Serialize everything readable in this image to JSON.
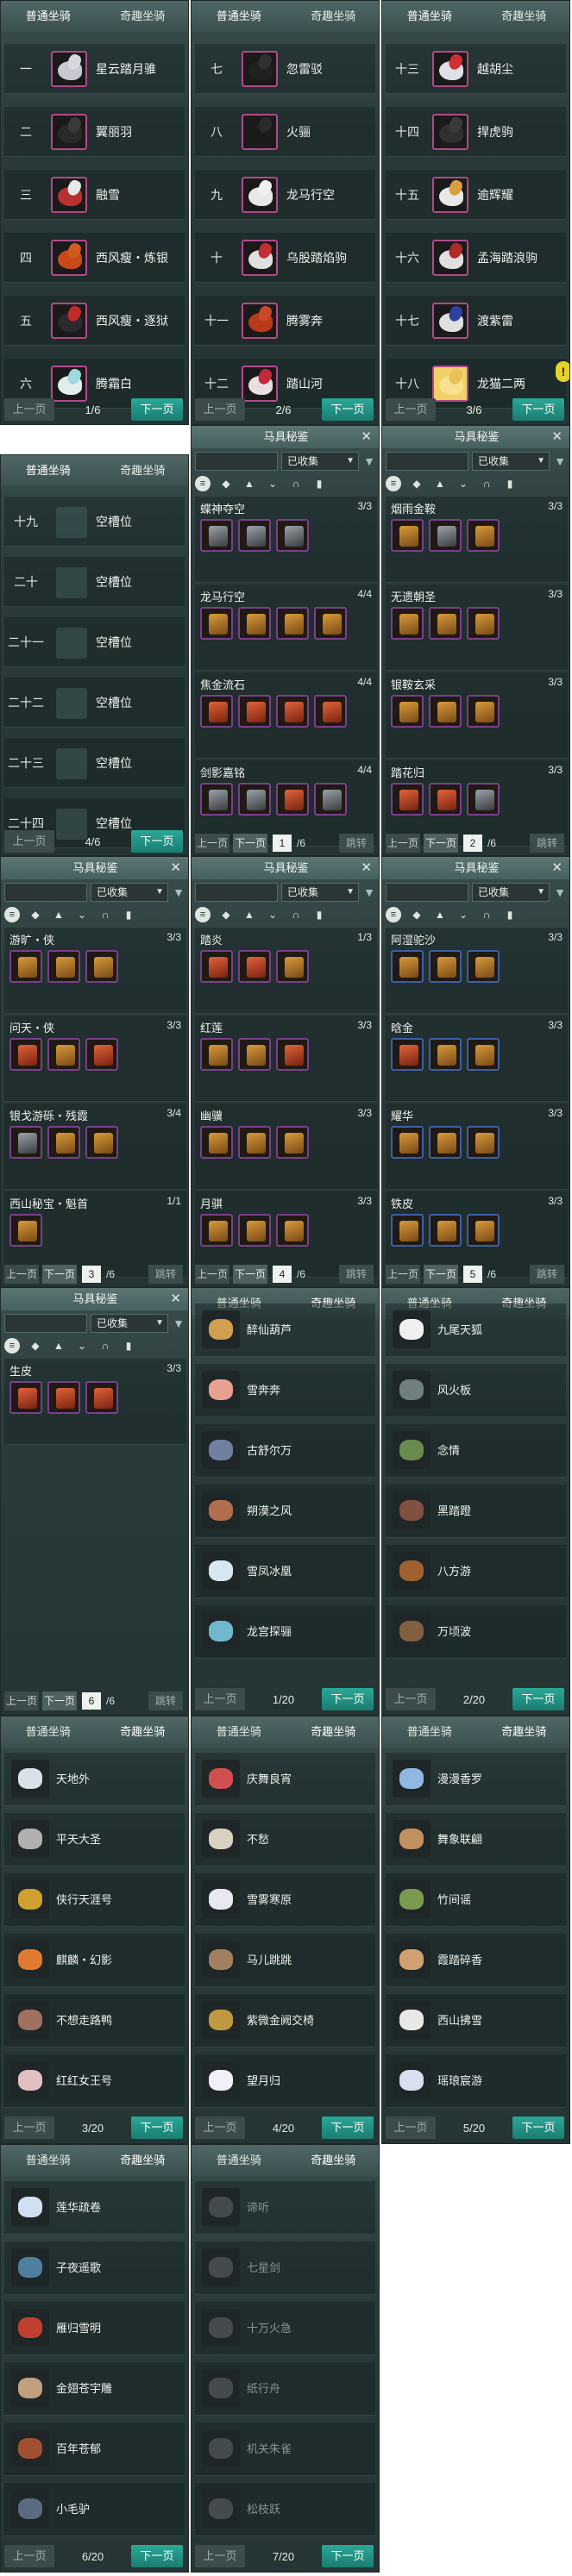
{
  "tabs": {
    "normal": "普通坐骑",
    "fun": "奇趣坐骑"
  },
  "pager": {
    "prev": "上一页",
    "next": "下一页"
  },
  "panel_normal_1": {
    "rows": [
      {
        "num": "一",
        "name": "星云踏月骓"
      },
      {
        "num": "二",
        "name": "翼丽羽"
      },
      {
        "num": "三",
        "name": "融雪"
      },
      {
        "num": "四",
        "name": "西风瘦・炼银"
      },
      {
        "num": "五",
        "name": "西风瘦・逐狱"
      },
      {
        "num": "六",
        "name": "腾霜白"
      }
    ],
    "page": "1/6"
  },
  "panel_normal_2": {
    "rows": [
      {
        "num": "七",
        "name": "忽雷驳"
      },
      {
        "num": "八",
        "name": "火骊"
      },
      {
        "num": "九",
        "name": "龙马行空"
      },
      {
        "num": "十",
        "name": "乌股踏焰驹"
      },
      {
        "num": "十一",
        "name": "腾雾奔"
      },
      {
        "num": "十二",
        "name": "踏山河"
      }
    ],
    "page": "2/6"
  },
  "panel_normal_3": {
    "rows": [
      {
        "num": "十三",
        "name": "越胡尘"
      },
      {
        "num": "十四",
        "name": "捍虎驹"
      },
      {
        "num": "十五",
        "name": "逾辉耀"
      },
      {
        "num": "十六",
        "name": "孟海踏浪驹"
      },
      {
        "num": "十七",
        "name": "渡紫雷"
      },
      {
        "num": "十八",
        "name": "龙猫二两"
      }
    ],
    "page": "3/6",
    "badge": "!"
  },
  "panel_normal_4": {
    "rows": [
      {
        "num": "十九",
        "name": "空槽位"
      },
      {
        "num": "二十",
        "name": "空槽位"
      },
      {
        "num": "二十一",
        "name": "空槽位"
      },
      {
        "num": "二十二",
        "name": "空槽位"
      },
      {
        "num": "二十三",
        "name": "空槽位"
      },
      {
        "num": "二十四",
        "name": "空槽位"
      }
    ],
    "page": "4/6"
  },
  "codex": {
    "title": "马具秘鉴",
    "close": "✕",
    "filter_value": "已收集",
    "jump": "跳转",
    "total": "/6"
  },
  "codex_1": {
    "sets": [
      {
        "name": "蝶神夺空",
        "count": "3/3"
      },
      {
        "name": "龙马行空",
        "count": "4/4"
      },
      {
        "name": "焦金流石",
        "count": "4/4"
      },
      {
        "name": "剑影嘉铭",
        "count": "4/4"
      }
    ],
    "page": "1"
  },
  "codex_2": {
    "sets": [
      {
        "name": "烟雨金鞍",
        "count": "3/3"
      },
      {
        "name": "无遗朝圣",
        "count": "3/3"
      },
      {
        "name": "银鞍玄采",
        "count": "3/3"
      },
      {
        "name": "踏花归",
        "count": "3/3"
      }
    ],
    "page": "2"
  },
  "codex_3": {
    "sets": [
      {
        "name": "游旷・侠",
        "count": "3/3"
      },
      {
        "name": "问天・侠",
        "count": "3/3"
      },
      {
        "name": "银戈游砾・残霞",
        "count": "3/4"
      },
      {
        "name": "西山秘宝・魁首",
        "count": "1/1"
      }
    ],
    "page": "3"
  },
  "codex_4": {
    "sets": [
      {
        "name": "踏炎",
        "count": "1/3"
      },
      {
        "name": "红莲",
        "count": "3/3"
      },
      {
        "name": "幽骥",
        "count": "3/3"
      },
      {
        "name": "月骐",
        "count": "3/3"
      }
    ],
    "page": "4"
  },
  "codex_5": {
    "sets": [
      {
        "name": "阿湿驼沙",
        "count": "3/3"
      },
      {
        "name": "晗金",
        "count": "3/3"
      },
      {
        "name": "耀华",
        "count": "3/3"
      },
      {
        "name": "铁皮",
        "count": "3/3"
      }
    ],
    "page": "5"
  },
  "codex_6": {
    "sets": [
      {
        "name": "生皮",
        "count": "3/3"
      }
    ],
    "page": "6"
  },
  "fun_1": {
    "rows": [
      "醉仙葫芦",
      "雪奔奔",
      "古舒尔万",
      "朔漠之风",
      "雪凤冰凰",
      "龙宫探骊"
    ],
    "page": "1/20"
  },
  "fun_2": {
    "rows": [
      "九尾天狐",
      "风火板",
      "念情",
      "黑踏蹬",
      "八方游",
      "万顷波"
    ],
    "page": "2/20"
  },
  "fun_3": {
    "rows": [
      "天地外",
      "平天大圣",
      "侠行天涯号",
      "麒麟・幻影",
      "不想走路鸭",
      "红红女王号"
    ],
    "page": "3/20"
  },
  "fun_4": {
    "rows": [
      "庆舞良宵",
      "不愁",
      "雪雾寒原",
      "马儿跳跳",
      "紫微金阙交椅",
      "望月归"
    ],
    "page": "4/20"
  },
  "fun_5": {
    "rows": [
      "漫漫香罗",
      "舞象联翩",
      "竹间谣",
      "霞踏碎香",
      "西山拂雪",
      "瑶琅宸游"
    ],
    "page": "5/20"
  },
  "fun_6": {
    "rows": [
      "莲华疏卷",
      "子夜遥歌",
      "雁归雪明",
      "金翅苍宇雕",
      "百年苍郁",
      "小毛驴"
    ],
    "page": "6/20"
  },
  "fun_7": {
    "rows": [
      "谛听",
      "七星剑",
      "十万火急",
      "纸行舟",
      "机关朱雀",
      "松枝跃"
    ],
    "page": "7/20"
  }
}
